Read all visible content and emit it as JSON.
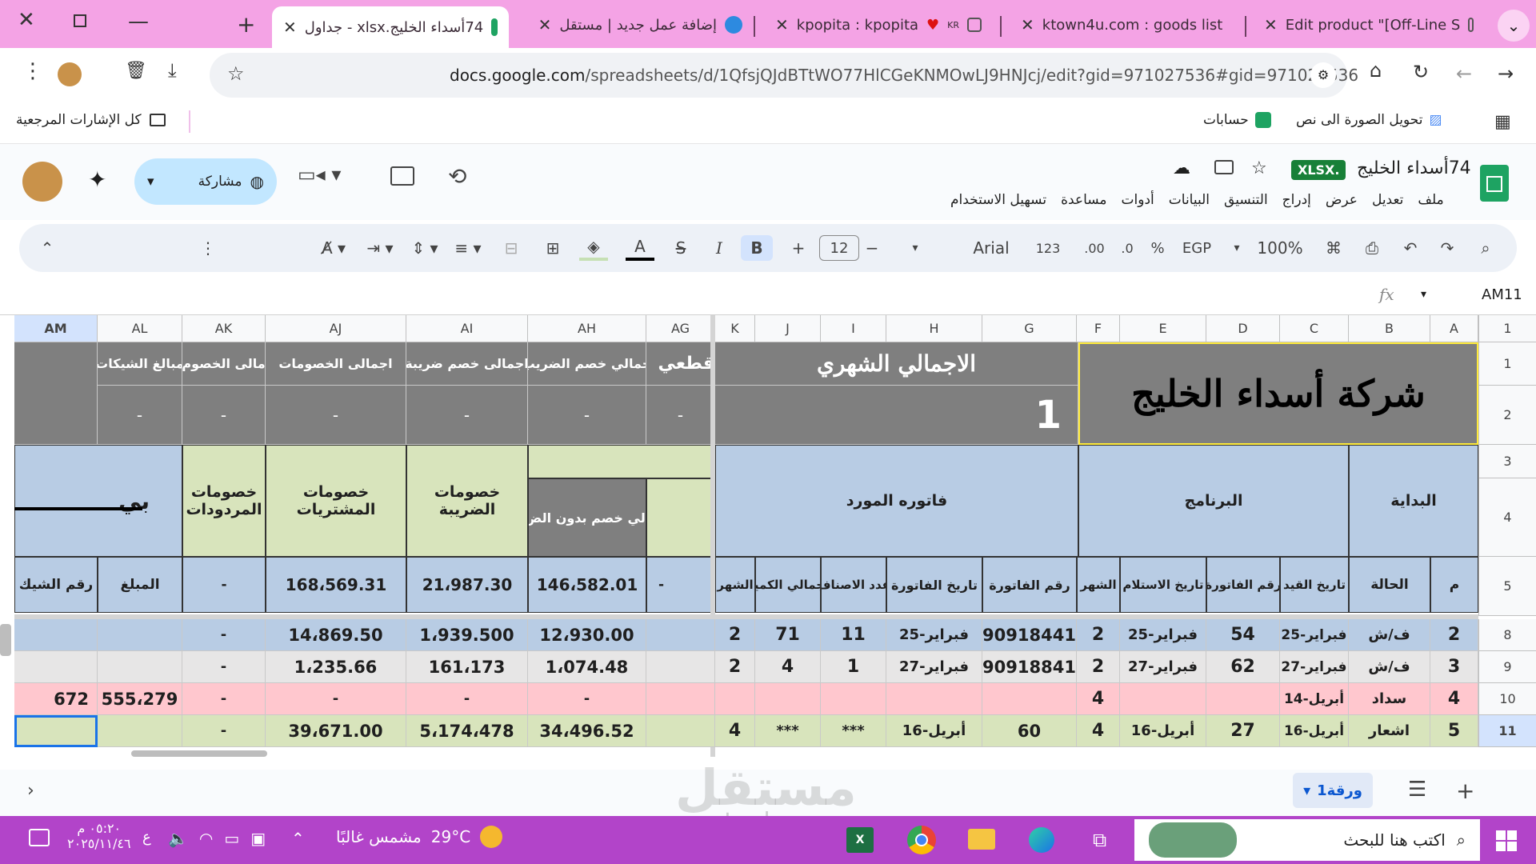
{
  "browser": {
    "tabs": [
      {
        "title": "74أسداء الخليج.xlsx - جداول",
        "active": true
      },
      {
        "title": "إضافة عمل جديد | مستقل"
      },
      {
        "title": "kpopita : kpopita",
        "badge": "KR"
      },
      {
        "title": "ktown4u.com : goods list"
      },
      {
        "title": "Edit product \"[Off-Line S"
      }
    ],
    "url_host": "docs.google.com",
    "url_path": "/spreadsheets/d/1QfsjQJdBTtWO77HlCGeKNMOwLJ9HNJcj/edit?gid=971027536#gid=971027536",
    "bookmarks": {
      "all_bookmarks": "كل الإشارات المرجعية",
      "accounts": "حسابات",
      "image_to_text": "تحويل الصورة الى نص"
    }
  },
  "doc": {
    "title": "74أسداء الخليج",
    "format_badge": "XLSX.",
    "share_label": "مشاركة",
    "menus": [
      "ملف",
      "تعديل",
      "عرض",
      "إدراج",
      "التنسيق",
      "البيانات",
      "أدوات",
      "مساعدة",
      "تسهيل الاستخدام"
    ]
  },
  "toolbar": {
    "zoom": "100%",
    "currency": "EGP",
    "percent": "%",
    "dec_less": ".0",
    "dec_more": ".00",
    "format": "123",
    "font": "Arial",
    "font_size": "12",
    "bold": "B",
    "italic": "I"
  },
  "formula": {
    "cell_ref": "AM11",
    "fx": "fx"
  },
  "columns": [
    "A",
    "B",
    "C",
    "D",
    "E",
    "F",
    "G",
    "H",
    "I",
    "J",
    "K",
    "AG",
    "AH",
    "AI",
    "AJ",
    "AK",
    "AL",
    "AM"
  ],
  "rows": [
    "1",
    "2",
    "3",
    "4",
    "5",
    "8",
    "9",
    "10",
    "11"
  ],
  "sheet": {
    "company": "شركة أسداء الخليج",
    "monthly_total": "الاجمالي الشهري",
    "month_number": "1",
    "partial_header": "قطعي",
    "totals_headers": {
      "ah": "جمالي خصم الضريب",
      "ai": "اجمالى خصم ضريبة",
      "aj": "اجمالى الخصومات",
      "ak": "مالى الخصوم",
      "al": "مبالغ الشيكات"
    },
    "dash": "-",
    "groups": {
      "start": "البداية",
      "program": "البرنامج",
      "supplier_invoice": "فاتوره المورد",
      "tax_discounts": "خصومات الضريبة",
      "purchase_discounts": "خصومات المشتريات",
      "return_discounts": "خصومات المردودات",
      "ah4": "الي خصم بدون الض",
      "am4": "بي"
    },
    "col_headers": {
      "a": "م",
      "b": "الحالة",
      "c": "تاريخ القيد",
      "d": "رقم الفاتورة",
      "e": "تاريخ الاستلام",
      "f": "الشهر",
      "g": "رقم الفاتورة",
      "h": "تاريخ الفاتورة",
      "i": "عدد الاصناف",
      "j": "اجمالي الكمية",
      "k": "الشهر",
      "ag": "-",
      "ah": "146،582.01",
      "ai": "21،987.30",
      "aj": "168،569.31",
      "ak": "-",
      "al": "المبلغ",
      "am": "رقم الشيك"
    },
    "data_rows": [
      {
        "a": "2",
        "b": "ف/ش",
        "c": "فبراير-25",
        "d": "54",
        "e": "فبراير-25",
        "f": "2",
        "g": "90918441",
        "h": "فبراير-25",
        "i": "11",
        "j": "71",
        "k": "2",
        "ag": "",
        "ah": "12،930.00",
        "ai": "1،939.500",
        "aj": "14،869.50",
        "ak": "-",
        "al": "",
        "am": ""
      },
      {
        "a": "3",
        "b": "ف/ش",
        "c": "فبراير-27",
        "d": "62",
        "e": "فبراير-27",
        "f": "2",
        "g": "90918841",
        "h": "فبراير-27",
        "i": "1",
        "j": "4",
        "k": "2",
        "ag": "",
        "ah": "1،074.48",
        "ai": "161،173",
        "aj": "1،235.66",
        "ak": "-",
        "al": "",
        "am": ""
      },
      {
        "a": "4",
        "b": "سداد",
        "c": "أبريل-14",
        "d": "",
        "e": "",
        "f": "4",
        "g": "",
        "h": "",
        "i": "",
        "j": "",
        "k": "",
        "ag": "",
        "ah": "-",
        "ai": "-",
        "aj": "-",
        "ak": "-",
        "al": "555،279",
        "am": "672"
      },
      {
        "a": "5",
        "b": "اشعار",
        "c": "أبريل-16",
        "d": "27",
        "e": "أبريل-16",
        "f": "4",
        "g": "60",
        "h": "أبريل-16",
        "i": "***",
        "j": "***",
        "k": "4",
        "ag": "",
        "ah": "34،496.52",
        "ai": "5،174،478",
        "aj": "39،671.00",
        "ak": "-",
        "al": "",
        "am": ""
      }
    ]
  },
  "sheet_tabs": {
    "active": "ورقة1"
  },
  "watermark": {
    "text": "مستقل",
    "sub": "mostaql.com"
  },
  "taskbar": {
    "search": "اكتب هنا للبحث",
    "weather": "مشمس غالبًا",
    "temp": "29°C",
    "time": "٠٥:٢٠ م",
    "date": "٢٠٢٥/١١/٤٦",
    "lang": "ع"
  }
}
